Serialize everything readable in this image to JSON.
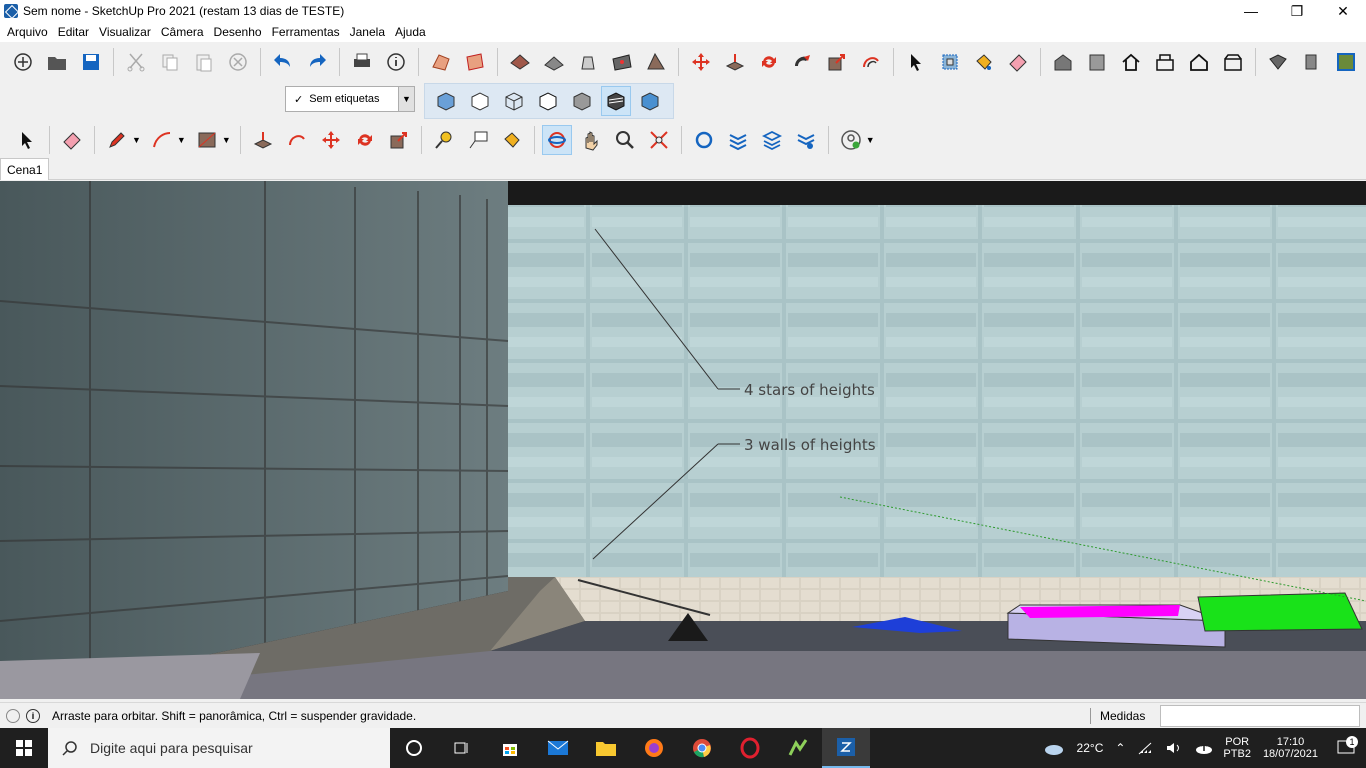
{
  "window": {
    "title": "Sem nome - SketchUp Pro 2021 (restam 13 dias de TESTE)",
    "controls": {
      "minimize": "—",
      "maximize": "❐",
      "close": "✕"
    }
  },
  "menu": {
    "items": [
      "Arquivo",
      "Editar",
      "Visualizar",
      "Câmera",
      "Desenho",
      "Ferramentas",
      "Janela",
      "Ajuda"
    ]
  },
  "tags": {
    "selected": "Sem etiquetas",
    "check": "✓"
  },
  "scenes": {
    "tabs": [
      "Cena1"
    ]
  },
  "viewport": {
    "annotations": [
      "4 stars of heights",
      "3 walls of heights"
    ]
  },
  "status": {
    "message": "Arraste para orbitar. Shift = panorâmica, Ctrl = suspender gravidade.",
    "measures_label": "Medidas",
    "measures_value": ""
  },
  "taskbar": {
    "search_placeholder": "Digite aqui para pesquisar",
    "weather": "22°C",
    "lang_top": "POR",
    "lang_bottom": "PTB2",
    "time": "17:10",
    "date": "18/07/2021",
    "notifications": "1"
  },
  "colors": {
    "accent": "#0078d7",
    "taskbar": "#1f1f1f",
    "magenta_object": "#ff00ff",
    "green_object": "#19e219",
    "blue_object": "#1e3fd8"
  }
}
